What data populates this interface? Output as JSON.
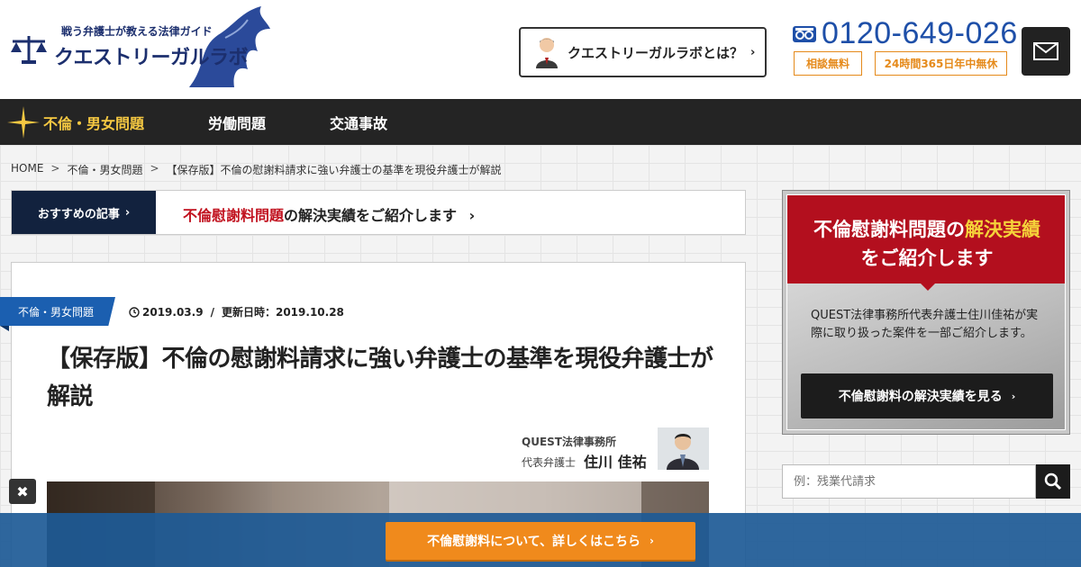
{
  "header": {
    "tagline": "戦う弁護士が教える法律ガイド",
    "site_name": "クエストリーガルラボ",
    "about_label": "クエストリーガルラボとは？",
    "phone_number": "0120-649-026",
    "badge_free": "相談無料",
    "badge_hours": "24時間365日年中無休"
  },
  "nav": {
    "items": [
      {
        "label": "不倫・男女問題"
      },
      {
        "label": "労働問題"
      },
      {
        "label": "交通事故"
      }
    ]
  },
  "breadcrumb": {
    "home": "HOME",
    "sep": ">",
    "category": "不倫・男女問題",
    "current": "【保存版】不倫の慰謝料請求に強い弁護士の基準を現役弁護士が解説"
  },
  "recommend": {
    "label": "おすすめの記事",
    "highlight": "不倫慰謝料問題",
    "text": "の解決実績をご紹介します"
  },
  "article": {
    "category": "不倫・男女問題",
    "published": "2019.03.9",
    "updated_label": "更新日時：",
    "updated": "2019.10.28",
    "title": "【保存版】不倫の慰謝料請求に強い弁護士の基準を現役弁護士が解説",
    "author_org": "QUEST法律事務所",
    "author_role": "代表弁護士",
    "author_name": "住川 佳祐"
  },
  "sidebar": {
    "banner_title_a": "不倫慰謝料問題の",
    "banner_title_b": "解決実績",
    "banner_title2": "をご紹介します",
    "banner_desc": "QUEST法律事務所代表弁護士住川佳祐が実際に取り扱った案件を一部ご紹介します。",
    "banner_button": "不倫慰謝料の解決実績を見る",
    "search_placeholder": "例：残業代請求"
  },
  "bottom_bar": {
    "cta": "不倫慰謝料について、詳しくはこちら",
    "close": "✖"
  },
  "colors": {
    "brand_navy": "#1c2f6e",
    "phone_blue": "#1e4fa8",
    "accent_orange": "#f08a1c",
    "accent_red": "#b30f1e",
    "nav_active": "#f5c842"
  }
}
